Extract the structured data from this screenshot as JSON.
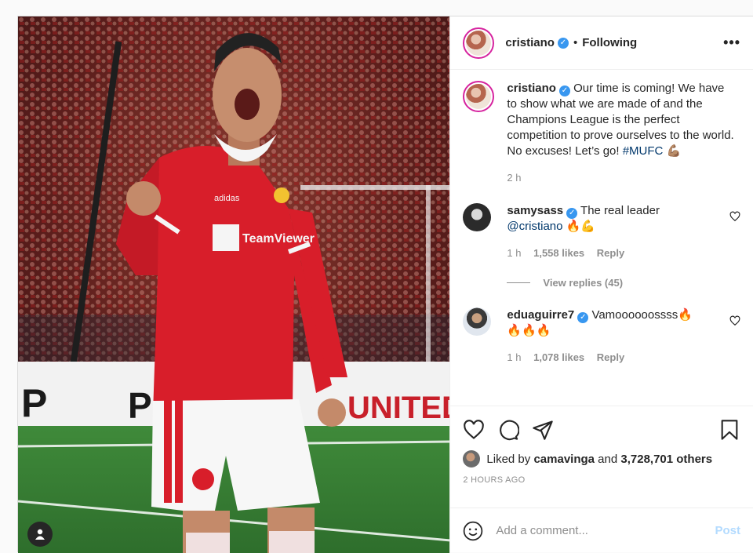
{
  "post": {
    "author": "cristiano",
    "follow_status": "Following",
    "more_icon": "•••",
    "caption": {
      "username": "cristiano",
      "text": "Our time is coming! We have to show what we are made of and the Champions League is the perfect competition to prove ourselves to the world. No excuses! Let’s go!",
      "hashtag": "#MUFC",
      "emoji": "💪🏽",
      "age": "2 h"
    },
    "comments": [
      {
        "username": "samysass",
        "text": "The real leader",
        "mention": "@cristiano",
        "emoji": "🔥💪",
        "age": "1 h",
        "likes": "1,558 likes",
        "reply_label": "Reply",
        "view_replies": "View replies (45)"
      },
      {
        "username": "eduaguirre7",
        "text": "Vamoooooossss🔥",
        "emoji": "🔥🔥🔥",
        "age": "1 h",
        "likes": "1,078 likes",
        "reply_label": "Reply"
      }
    ],
    "liked_by": {
      "prefix": "Liked by",
      "user": "camavinga",
      "and": "and",
      "others": "3,728,701 others"
    },
    "timestamp": "2 HOURS AGO",
    "add_comment": {
      "placeholder": "Add a comment...",
      "post_label": "Post"
    }
  },
  "colors": {
    "verified": "#3897f0",
    "link": "#00376b",
    "muted": "#8e8e8e",
    "post_disabled": "#b3dbff",
    "jersey_red": "#d81e2a"
  },
  "photo": {
    "jersey_sponsor": "TeamViewer",
    "kit_brand": "adidas"
  }
}
